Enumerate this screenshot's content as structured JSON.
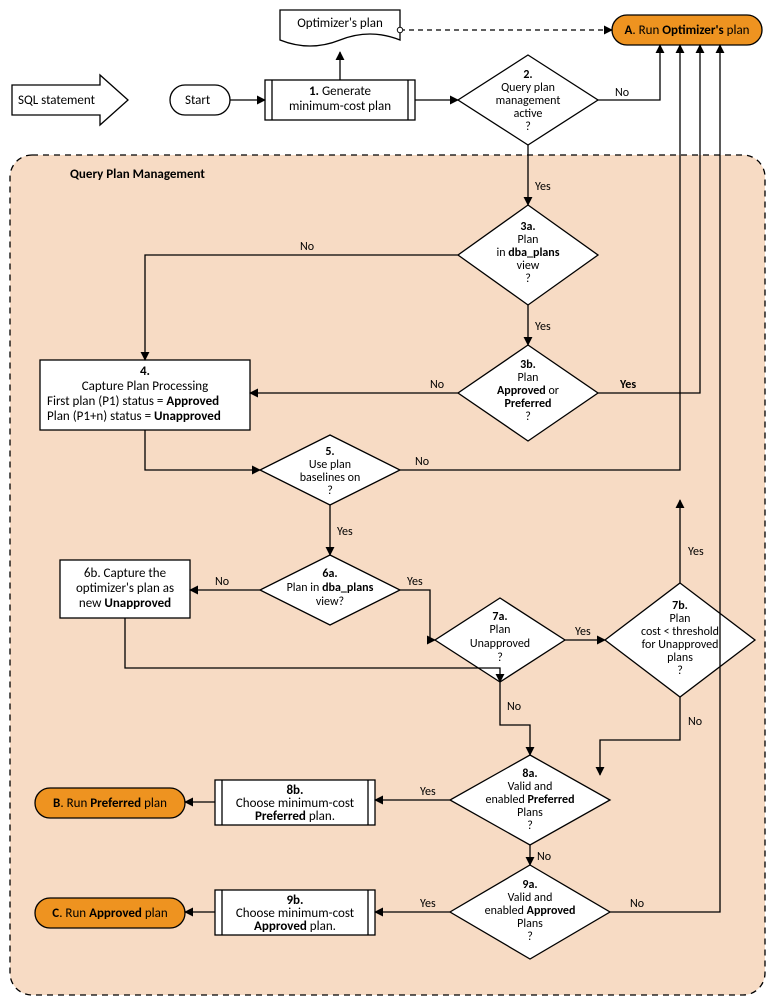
{
  "input": {
    "label": "SQL statement"
  },
  "start": {
    "label": "Start"
  },
  "node1": {
    "num": "1.",
    "l1": "Generate",
    "l2": "minimum-cost plan"
  },
  "optplan": {
    "label": "Optimizer's plan"
  },
  "nodeA": {
    "num": "A",
    "l1": ". Run ",
    "l2": "Optimizer's",
    "l3": " plan"
  },
  "node2": {
    "num": "2.",
    "l1": "Query plan",
    "l2": "management",
    "l3": "active",
    "l4": "?"
  },
  "qpm": {
    "title": "Query Plan Management"
  },
  "node3a": {
    "num": "3a.",
    "l1": "Plan",
    "l2a": "in ",
    "l2b": "dba_plans",
    "l3": "view",
    "l4": "?"
  },
  "node3b": {
    "num": "3b.",
    "l1": "Plan",
    "l2a": "Approved",
    "l2b": " or",
    "l3": "Preferred",
    "l4": "?"
  },
  "node4": {
    "num": "4.",
    "l1": "Capture Plan Processing",
    "l2a": "First plan (P1) status = ",
    "l2b": "Approved",
    "l3a": "Plan (P1+n) status = ",
    "l3b": "Unapproved"
  },
  "node5": {
    "num": "5.",
    "l1": "Use plan",
    "l2": "baselines on",
    "l3": "?"
  },
  "node6a": {
    "num": "6a.",
    "l1a": "Plan in ",
    "l1b": "dba_plans",
    "l2": "view?"
  },
  "node6b": {
    "l1": "6b. Capture the",
    "l2": "optimizer's plan as",
    "l3a": "new ",
    "l3b": "Unapproved"
  },
  "node7a": {
    "num": "7a.",
    "l1": "Plan",
    "l2": "Unapproved",
    "l3": "?"
  },
  "node7b": {
    "num": "7b.",
    "l1": "Plan",
    "l2": "cost < threshold",
    "l3": "for Unapproved",
    "l4": "plans",
    "l5": "?"
  },
  "node8a": {
    "num": "8a.",
    "l1": "Valid and",
    "l2a": "enabled ",
    "l2b": "Preferred",
    "l3": "Plans",
    "l4": "?"
  },
  "node8b": {
    "num": "8b.",
    "l1": "Choose minimum-cost",
    "l2a": "Preferred",
    "l2b": " plan."
  },
  "nodeB": {
    "num": "B",
    "l1": ". Run ",
    "l2": "Preferred",
    "l3": " plan"
  },
  "node9a": {
    "num": "9a.",
    "l1": "Valid and",
    "l2a": "enabled ",
    "l2b": "Approved",
    "l3": "Plans",
    "l4": "?"
  },
  "node9b": {
    "num": "9b.",
    "l1": "Choose minimum-cost",
    "l2a": "Approved",
    "l2b": " plan."
  },
  "nodeC": {
    "num": "C",
    "l1": ". Run ",
    "l2": "Approved",
    "l3": " plan"
  },
  "labels": {
    "yes": "Yes",
    "no": "No"
  }
}
